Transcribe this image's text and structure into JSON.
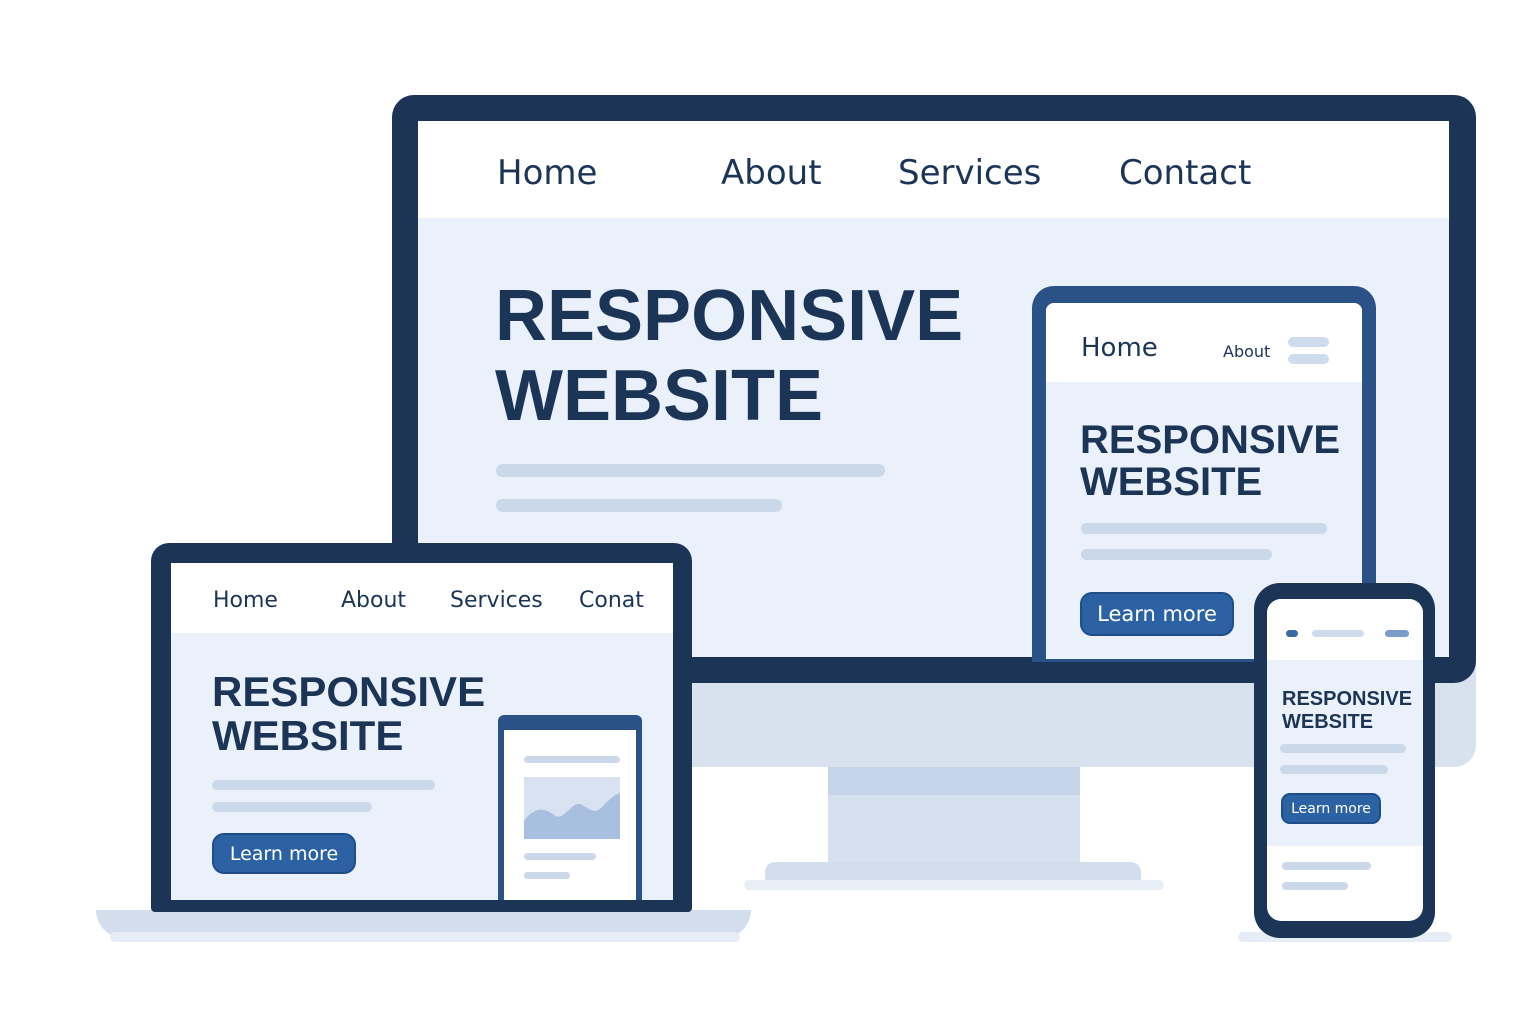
{
  "desktop": {
    "nav": [
      "Home",
      "About",
      "Services",
      "Contact"
    ],
    "hero_line1": "RESPONSIVE",
    "hero_line2": "WEBSITE"
  },
  "tablet": {
    "nav_home": "Home",
    "nav_about": "About",
    "hero_line1": "RESPONSIVE",
    "hero_line2": "WEBSITE",
    "button": "Learn more"
  },
  "laptop": {
    "nav": [
      "Home",
      "About",
      "Services",
      "Conat"
    ],
    "hero_line1": "RESPONSIVE",
    "hero_line2": "WEBSITE",
    "button": "Learn more"
  },
  "phone": {
    "hero_line1": "RESPONSIVE",
    "hero_line2": "WEBSITE",
    "button": "Learn more"
  },
  "colors": {
    "frame": "#1c3557",
    "screen": "#ebf1fa",
    "accent": "#2c62a3",
    "placeholder": "#cbd8ea"
  }
}
